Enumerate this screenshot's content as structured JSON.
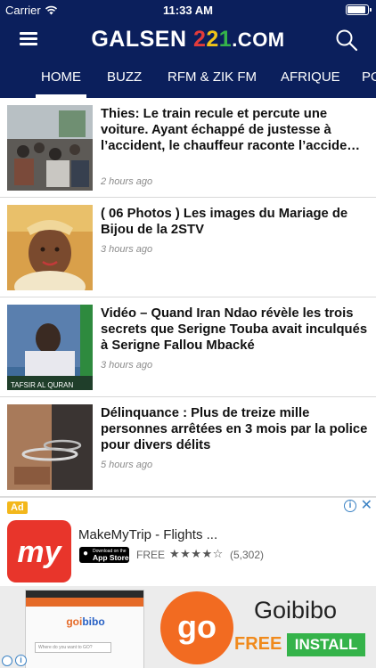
{
  "status_bar": {
    "carrier": "Carrier",
    "time": "11:33 AM",
    "battery_level": 1.0
  },
  "header": {
    "logo_part1": "GALSEN ",
    "logo_d1": "2",
    "logo_d2": "2",
    "logo_d3": "1",
    "logo_part2": ".COM"
  },
  "tabs": [
    {
      "label": "HOME",
      "active": true
    },
    {
      "label": "BUZZ"
    },
    {
      "label": "RFM & ZIK FM"
    },
    {
      "label": "AFRIQUE"
    },
    {
      "label": "PO"
    }
  ],
  "articles": [
    {
      "title_lines": [
        "Thies: Le train recule et percute une",
        "voiture. Ayant échappé de justesse à",
        "l’accident, le chauffeur raconte l’accide…"
      ],
      "time": "2 hours ago"
    },
    {
      "title_lines": [
        "( 06 Photos ) Les images du Mariage de",
        "Bijou de la 2STV"
      ],
      "time": "3 hours ago"
    },
    {
      "title_lines": [
        "Vidéo – Quand Iran Ndao révèle les trois",
        "secrets que Serigne Touba avait inculqués",
        "à Serigne Fallou Mbacké"
      ],
      "time": "3 hours ago",
      "thumb_caption": "TAFSIR AL QURAN"
    },
    {
      "title_lines": [
        "Délinquance : Plus de treize mille",
        "personnes arrêtées en 3 mois par la police",
        "pour divers délits"
      ],
      "time": "5 hours ago"
    }
  ],
  "ad1": {
    "badge": "Ad",
    "info": "i",
    "close": "✕",
    "logo_text": "my",
    "title": "MakeMyTrip - Flights ...",
    "store_small": "Download on the",
    "store_big": "App Store",
    "price": "FREE",
    "stars": "★★★★☆",
    "rating_count": "(5,302)"
  },
  "ad2": {
    "mini_logo_1": "goi",
    "mini_logo_2": "bibo",
    "mini_field": "Where do you want to GO?",
    "circle_text": "go",
    "name": "Goibibo",
    "free": "FREE",
    "install": "INSTALL",
    "info": "i"
  },
  "colors": {
    "nav": "#0b1f5c",
    "ad_badge": "#f3b71b",
    "install": "#35b34a",
    "go": "#f26b21"
  }
}
